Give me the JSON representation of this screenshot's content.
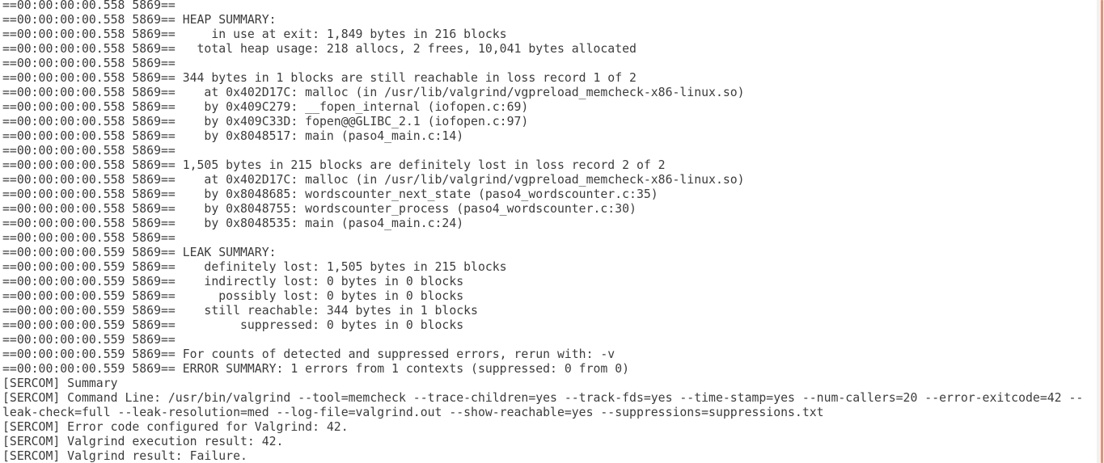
{
  "terminal": {
    "lines": [
      "==00:00:00:00.558 5869== ",
      "==00:00:00:00.558 5869== HEAP SUMMARY:",
      "==00:00:00:00.558 5869==     in use at exit: 1,849 bytes in 216 blocks",
      "==00:00:00:00.558 5869==   total heap usage: 218 allocs, 2 frees, 10,041 bytes allocated",
      "==00:00:00:00.558 5869== ",
      "==00:00:00:00.558 5869== 344 bytes in 1 blocks are still reachable in loss record 1 of 2",
      "==00:00:00:00.558 5869==    at 0x402D17C: malloc (in /usr/lib/valgrind/vgpreload_memcheck-x86-linux.so)",
      "==00:00:00:00.558 5869==    by 0x409C279: __fopen_internal (iofopen.c:69)",
      "==00:00:00:00.558 5869==    by 0x409C33D: fopen@@GLIBC_2.1 (iofopen.c:97)",
      "==00:00:00:00.558 5869==    by 0x8048517: main (paso4_main.c:14)",
      "==00:00:00:00.558 5869== ",
      "==00:00:00:00.558 5869== 1,505 bytes in 215 blocks are definitely lost in loss record 2 of 2",
      "==00:00:00:00.558 5869==    at 0x402D17C: malloc (in /usr/lib/valgrind/vgpreload_memcheck-x86-linux.so)",
      "==00:00:00:00.558 5869==    by 0x8048685: wordscounter_next_state (paso4_wordscounter.c:35)",
      "==00:00:00:00.558 5869==    by 0x8048755: wordscounter_process (paso4_wordscounter.c:30)",
      "==00:00:00:00.558 5869==    by 0x8048535: main (paso4_main.c:24)",
      "==00:00:00:00.558 5869== ",
      "==00:00:00:00.559 5869== LEAK SUMMARY:",
      "==00:00:00:00.559 5869==    definitely lost: 1,505 bytes in 215 blocks",
      "==00:00:00:00.559 5869==    indirectly lost: 0 bytes in 0 blocks",
      "==00:00:00:00.559 5869==      possibly lost: 0 bytes in 0 blocks",
      "==00:00:00:00.559 5869==    still reachable: 344 bytes in 1 blocks",
      "==00:00:00:00.559 5869==         suppressed: 0 bytes in 0 blocks",
      "==00:00:00:00.559 5869== ",
      "==00:00:00:00.559 5869== For counts of detected and suppressed errors, rerun with: -v",
      "==00:00:00:00.559 5869== ERROR SUMMARY: 1 errors from 1 contexts (suppressed: 0 from 0)",
      "[SERCOM] Summary",
      "[SERCOM] Command Line: /usr/bin/valgrind --tool=memcheck --trace-children=yes --track-fds=yes --time-stamp=yes --num-callers=20 --error-exitcode=42 --",
      "leak-check=full --leak-resolution=med --log-file=valgrind.out --show-reachable=yes --suppressions=suppressions.txt",
      "[SERCOM] Error code configured for Valgrind: 42.",
      "[SERCOM] Valgrind execution result: 42.",
      "[SERCOM] Valgrind result: Failure."
    ]
  },
  "colors": {
    "background": "#ffffff",
    "text": "#3c3c3c",
    "scrollbar_thumb": "#e2917a"
  }
}
